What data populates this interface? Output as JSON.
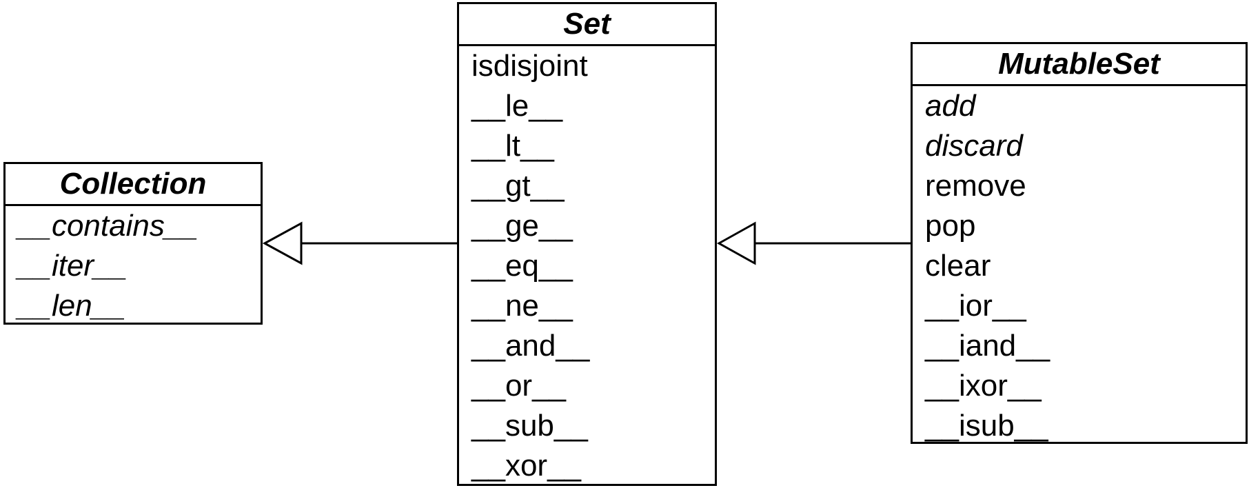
{
  "classes": {
    "collection": {
      "name": "Collection",
      "methods": [
        {
          "label": "__contains__",
          "abstract": true
        },
        {
          "label": "__iter__",
          "abstract": true
        },
        {
          "label": "__len__",
          "abstract": true
        }
      ]
    },
    "set": {
      "name": "Set",
      "methods": [
        {
          "label": "isdisjoint",
          "abstract": false
        },
        {
          "label": "__le__",
          "abstract": false
        },
        {
          "label": "__lt__",
          "abstract": false
        },
        {
          "label": "__gt__",
          "abstract": false
        },
        {
          "label": "__ge__",
          "abstract": false
        },
        {
          "label": "__eq__",
          "abstract": false
        },
        {
          "label": "__ne__",
          "abstract": false
        },
        {
          "label": "__and__",
          "abstract": false
        },
        {
          "label": "__or__",
          "abstract": false
        },
        {
          "label": "__sub__",
          "abstract": false
        },
        {
          "label": "__xor__",
          "abstract": false
        }
      ]
    },
    "mutableset": {
      "name": "MutableSet",
      "methods": [
        {
          "label": "add",
          "abstract": true
        },
        {
          "label": "discard",
          "abstract": true
        },
        {
          "label": "remove",
          "abstract": false
        },
        {
          "label": "pop",
          "abstract": false
        },
        {
          "label": "clear",
          "abstract": false
        },
        {
          "label": "__ior__",
          "abstract": false
        },
        {
          "label": "__iand__",
          "abstract": false
        },
        {
          "label": "__ixor__",
          "abstract": false
        },
        {
          "label": "__isub__",
          "abstract": false
        }
      ]
    }
  },
  "relations": [
    {
      "type": "inheritance",
      "from": "Set",
      "to": "Collection"
    },
    {
      "type": "inheritance",
      "from": "MutableSet",
      "to": "Set"
    }
  ],
  "colors": {
    "line": "#000000",
    "background": "#ffffff"
  }
}
